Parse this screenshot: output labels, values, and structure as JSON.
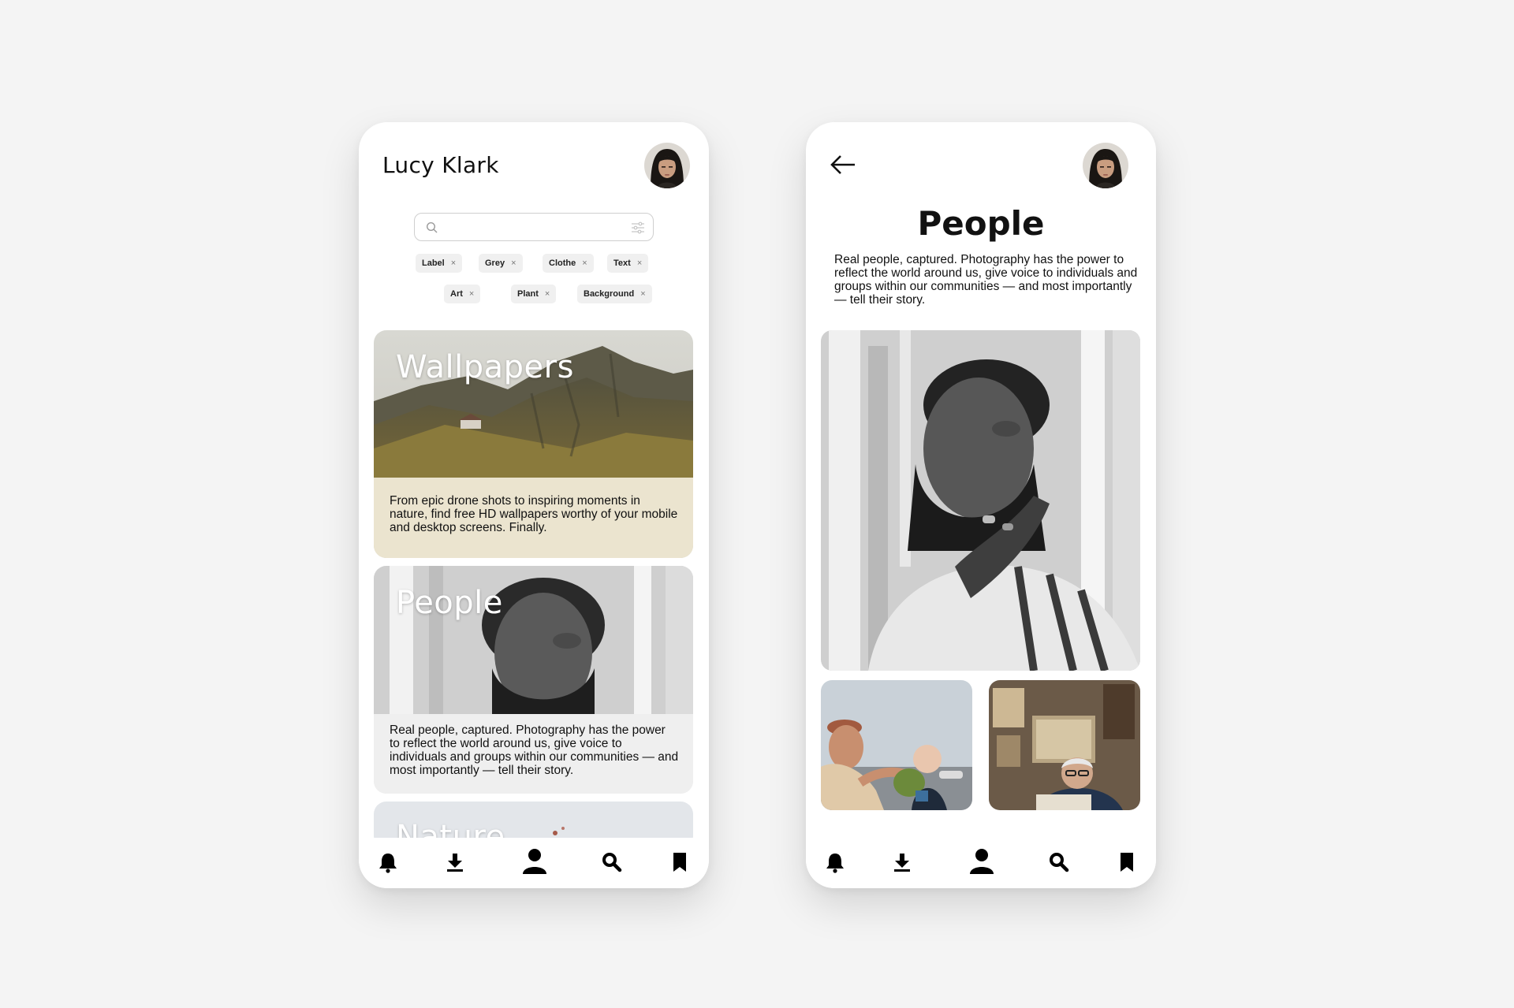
{
  "left_screen": {
    "user_name": "Lucy Klark",
    "avatar_icon": "user-avatar-icon",
    "search": {
      "value": "",
      "placeholder": "",
      "icon": "search-icon",
      "filter_icon": "filter-sliders-icon"
    },
    "tags": [
      {
        "label": "Label"
      },
      {
        "label": "Grey"
      },
      {
        "label": "Clothe"
      },
      {
        "label": "Text"
      },
      {
        "label": "Art"
      },
      {
        "label": "Plant"
      },
      {
        "label": "Background"
      }
    ],
    "tag_remove_glyph": "×",
    "cards": [
      {
        "title": "Wallpapers",
        "text": "From epic drone shots to inspiring moments in nature, find free HD wallpapers worthy of your mobile and desktop screens. Finally."
      },
      {
        "title": "People",
        "text": "Real people, captured. Photography has the power to reflect the world around us, give voice to individuals and groups within our communities — and most importantly — tell their story."
      },
      {
        "title": "Nature",
        "text": ""
      }
    ]
  },
  "right_screen": {
    "back_icon": "arrow-left-icon",
    "title": "People",
    "description": "Real people, captured. Photography has the power to reflect the world around us, give voice to individuals and groups within our communities — and most importantly — tell their story."
  },
  "bottom_nav": {
    "items": [
      {
        "icon": "bell-icon"
      },
      {
        "icon": "download-icon"
      },
      {
        "icon": "profile-icon"
      },
      {
        "icon": "search-icon"
      },
      {
        "icon": "bookmark-icon"
      }
    ]
  },
  "colors": {
    "background": "#f4f4f4",
    "phone": "#ffffff",
    "chip": "#f0f0f0",
    "text": "#111111"
  }
}
